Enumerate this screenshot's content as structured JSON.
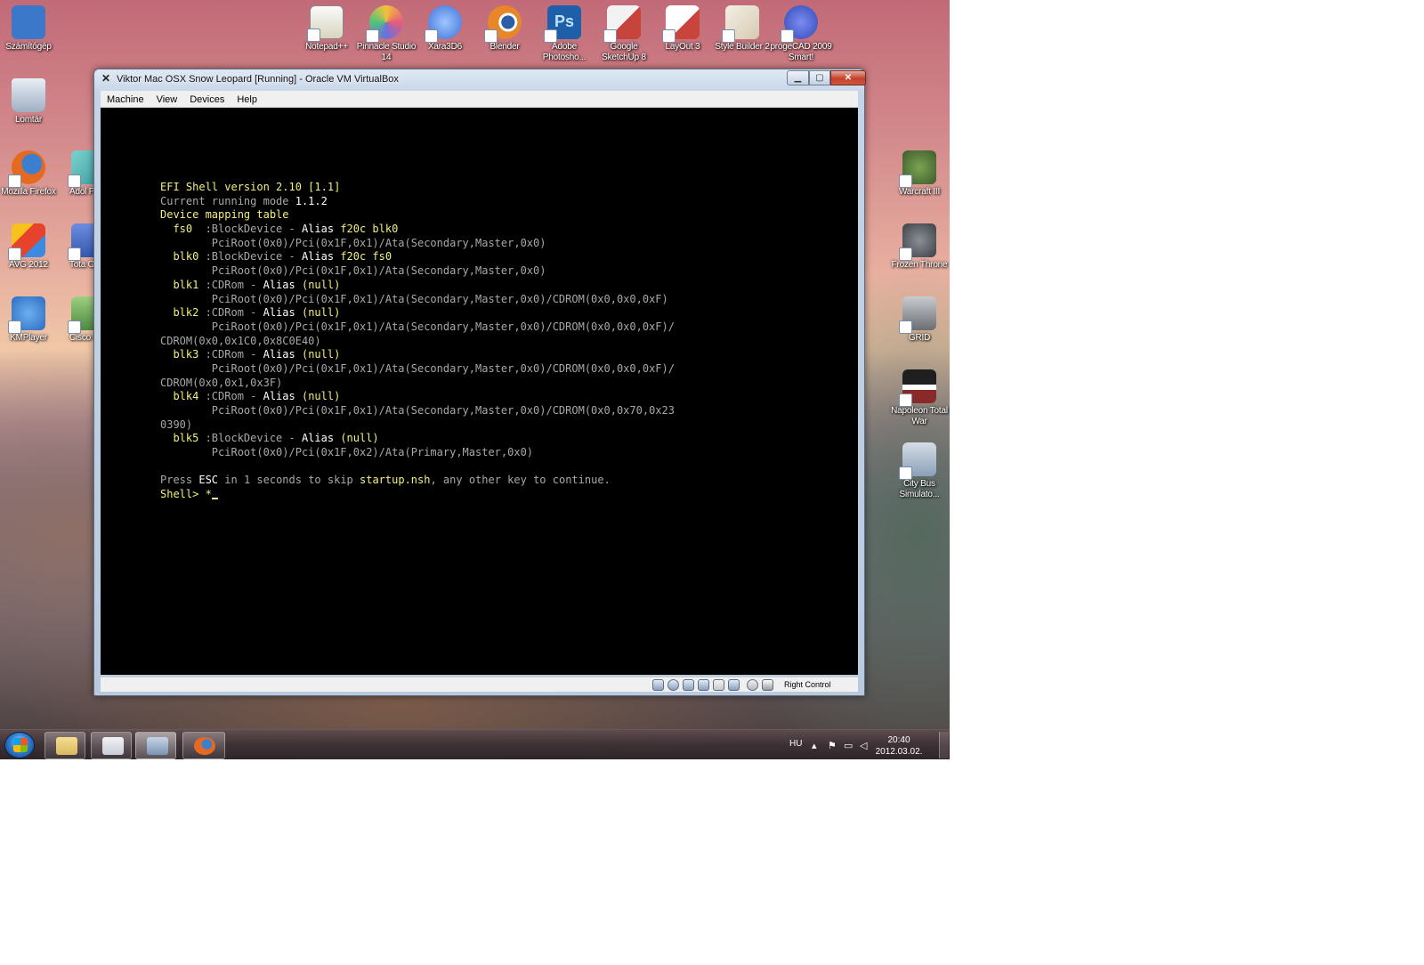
{
  "desktop": {
    "top_icons": [
      {
        "label": "Notepad++",
        "color": "#d9d4c0"
      },
      {
        "label": "Pinnacle Studio 14",
        "color": "#e65c7a"
      },
      {
        "label": "Xara3D6",
        "color": "#3a6fd8"
      },
      {
        "label": "Blender",
        "color": "#e8872a"
      },
      {
        "label": "Adobe Photosho...",
        "color": "#1d5fa8"
      },
      {
        "label": "Google SketchUp 8",
        "color": "#c7443c"
      },
      {
        "label": "LayOut 3",
        "color": "#c9443d"
      },
      {
        "label": "Style Builder 2",
        "color": "#d6c9b0"
      },
      {
        "label": "progeCAD 2009 Smart!",
        "color": "#3248b8"
      }
    ],
    "left_icons": [
      {
        "label": "Számítógép",
        "color": "#3b78c9"
      },
      {
        "label": "Lomtár",
        "color": "#b8c6d6"
      },
      {
        "label": "Mozilla Firefox",
        "color": "#e56a1f"
      },
      {
        "label": "AVG 2012",
        "color": "#e6422c"
      },
      {
        "label": "KMPlayer",
        "color": "#2d6bbf"
      }
    ],
    "left2_icons": [
      {
        "label": "Adol Photo",
        "color": "#3b9a9a"
      },
      {
        "label": "Tota Comma",
        "color": "#3558b0"
      },
      {
        "label": "Cisco P Trac",
        "color": "#4e8a44"
      }
    ],
    "right_icons": [
      {
        "label": "Warcraft III",
        "color": "#3d5a2a"
      },
      {
        "label": "Frozen Throne",
        "color": "#3c3f47"
      },
      {
        "label": "GRID",
        "color": "#6a6d72"
      },
      {
        "label": "Napoleon Total War",
        "color": "#8a2a28"
      },
      {
        "label": "City Bus Simulato...",
        "color": "#8aa0b8"
      }
    ]
  },
  "window": {
    "title": "Viktor Mac OSX Snow Leopard [Running] - Oracle VM VirtualBox",
    "menu": [
      "Machine",
      "View",
      "Devices",
      "Help"
    ],
    "status_host_key": "Right Control"
  },
  "console": {
    "lines": [
      [
        {
          "t": "EFI Shell version 2.10 [1.1]",
          "c": "y"
        }
      ],
      [
        {
          "t": "Current running mode ",
          "c": "g"
        },
        {
          "t": "1.1.2",
          "c": "w"
        }
      ],
      [
        {
          "t": "Device mapping table",
          "c": "y"
        }
      ],
      [
        {
          "t": "  fs0  ",
          "c": "y"
        },
        {
          "t": ":BlockDevice - ",
          "c": "g"
        },
        {
          "t": "Alias ",
          "c": "w"
        },
        {
          "t": "f20c blk0",
          "c": "y"
        }
      ],
      [
        {
          "t": "        PciRoot(0x0)/Pci(0x1F,0x1)/Ata(Secondary,Master,0x0)",
          "c": "g"
        }
      ],
      [
        {
          "t": "  blk0 ",
          "c": "y"
        },
        {
          "t": ":BlockDevice - ",
          "c": "g"
        },
        {
          "t": "Alias ",
          "c": "w"
        },
        {
          "t": "f20c fs0",
          "c": "y"
        }
      ],
      [
        {
          "t": "        PciRoot(0x0)/Pci(0x1F,0x1)/Ata(Secondary,Master,0x0)",
          "c": "g"
        }
      ],
      [
        {
          "t": "  blk1 ",
          "c": "y"
        },
        {
          "t": ":CDRom - ",
          "c": "g"
        },
        {
          "t": "Alias ",
          "c": "w"
        },
        {
          "t": "(null)",
          "c": "y"
        }
      ],
      [
        {
          "t": "        PciRoot(0x0)/Pci(0x1F,0x1)/Ata(Secondary,Master,0x0)/CDROM(0x0,0x0,0xF)",
          "c": "g"
        }
      ],
      [
        {
          "t": "  blk2 ",
          "c": "y"
        },
        {
          "t": ":CDRom - ",
          "c": "g"
        },
        {
          "t": "Alias ",
          "c": "w"
        },
        {
          "t": "(null)",
          "c": "y"
        }
      ],
      [
        {
          "t": "        PciRoot(0x0)/Pci(0x1F,0x1)/Ata(Secondary,Master,0x0)/CDROM(0x0,0x0,0xF)/",
          "c": "g"
        }
      ],
      [
        {
          "t": "CDROM(0x0,0x1C0,0x8C0E40)",
          "c": "g"
        }
      ],
      [
        {
          "t": "  blk3 ",
          "c": "y"
        },
        {
          "t": ":CDRom - ",
          "c": "g"
        },
        {
          "t": "Alias ",
          "c": "w"
        },
        {
          "t": "(null)",
          "c": "y"
        }
      ],
      [
        {
          "t": "        PciRoot(0x0)/Pci(0x1F,0x1)/Ata(Secondary,Master,0x0)/CDROM(0x0,0x0,0xF)/",
          "c": "g"
        }
      ],
      [
        {
          "t": "CDROM(0x0,0x1,0x3F)",
          "c": "g"
        }
      ],
      [
        {
          "t": "  blk4 ",
          "c": "y"
        },
        {
          "t": ":CDRom - ",
          "c": "g"
        },
        {
          "t": "Alias ",
          "c": "w"
        },
        {
          "t": "(null)",
          "c": "y"
        }
      ],
      [
        {
          "t": "        PciRoot(0x0)/Pci(0x1F,0x1)/Ata(Secondary,Master,0x0)/CDROM(0x0,0x70,0x23",
          "c": "g"
        }
      ],
      [
        {
          "t": "0390)",
          "c": "g"
        }
      ],
      [
        {
          "t": "  blk5 ",
          "c": "y"
        },
        {
          "t": ":BlockDevice - ",
          "c": "g"
        },
        {
          "t": "Alias ",
          "c": "w"
        },
        {
          "t": "(null)",
          "c": "y"
        }
      ],
      [
        {
          "t": "        PciRoot(0x0)/Pci(0x1F,0x2)/Ata(Primary,Master,0x0)",
          "c": "g"
        }
      ],
      [
        {
          "t": "",
          "c": "g"
        }
      ],
      [
        {
          "t": "Press ",
          "c": "g"
        },
        {
          "t": "ESC",
          "c": "w"
        },
        {
          "t": " in 1 seconds to skip ",
          "c": "g"
        },
        {
          "t": "startup.nsh",
          "c": "y"
        },
        {
          "t": ", any other key to continue.",
          "c": "g"
        }
      ],
      [
        {
          "t": "Shell> ",
          "c": "y"
        },
        {
          "t": "*",
          "c": "y"
        }
      ]
    ]
  },
  "taskbar": {
    "buttons": [
      {
        "name": "explorer",
        "color": "#d8b860"
      },
      {
        "name": "file-manager",
        "color": "#c9cdd6"
      },
      {
        "name": "virtualbox",
        "color": "#7c93b5"
      },
      {
        "name": "firefox",
        "color": "#e46a24"
      }
    ],
    "language": "HU",
    "time": "20:40",
    "date": "2012.03.02."
  }
}
